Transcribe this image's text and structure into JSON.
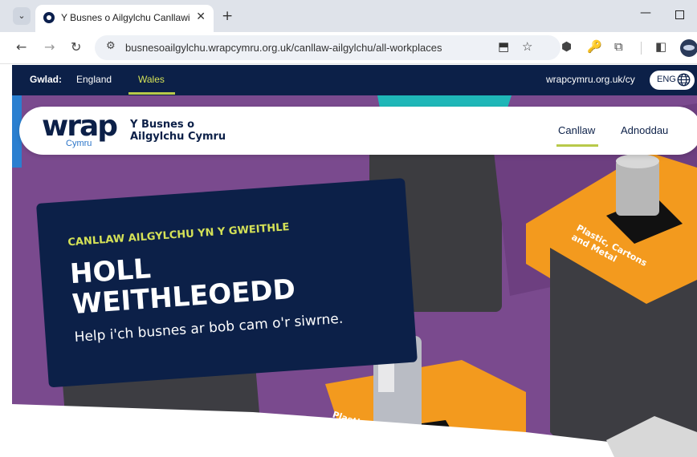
{
  "browser": {
    "tab_title": "Y Busnes o Ailgylchu Canllawiau",
    "url": "busnesoailgylchu.wrapcymru.org.uk/canllaw-ailgylchu/all-workplaces"
  },
  "country_bar": {
    "label": "Gwlad:",
    "england": "England",
    "wales": "Wales",
    "site_url": "wrapcymru.org.uk/cy",
    "language": "ENG"
  },
  "header": {
    "logo_text": "wrap",
    "logo_sub": "Cymru",
    "brand_line1": "Y Busnes o",
    "brand_line2": "Ailgylchu Cymru",
    "nav_canllaw": "Canllaw",
    "nav_adnoddau": "Adnoddau"
  },
  "hero": {
    "kicker": "CANLLAW AILGYLCHU YN Y GWEITHLE",
    "title_line1": "HOLL",
    "title_line2": "WEITHLEOEDD",
    "subtitle": "Help i'ch busnes ar bob cam o'r siwrne.",
    "bin_label_right": [
      "Plastic, Cartons",
      "and Metal"
    ],
    "bin_label_bottom": "Plastic, C"
  },
  "colors": {
    "navy": "#0c2048",
    "accent_lime": "#d4e157",
    "bin_orange": "#f39a1e",
    "bin_teal": "#1fb7b8",
    "bin_green": "#2fa84f",
    "backdrop_purple": "#7a4a8e"
  }
}
